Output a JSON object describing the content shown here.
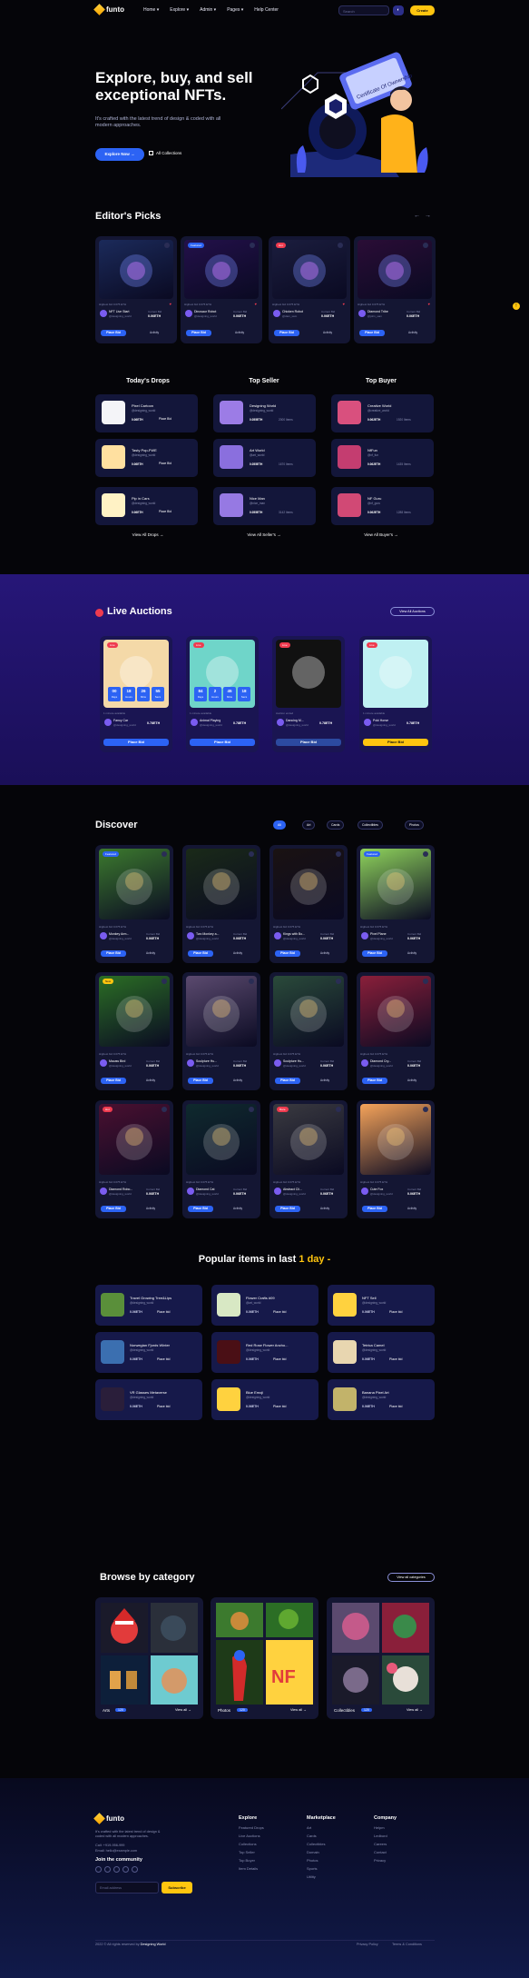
{
  "header": {
    "logo_text": "funto",
    "nav": [
      "Home ▾",
      "Explore ▾",
      "Admin ▾",
      "Pages ▾",
      "Help Center"
    ],
    "search_placeholder": "Search",
    "create_label": "Create"
  },
  "hero": {
    "title": "Explore, buy, and sell exceptional NFTs.",
    "subtitle": "It's crafted with the latest trend of design & coded with all modern approaches.",
    "explore_label": "Explore Now →",
    "collections_label": "All Collections",
    "certificate_text": "Certificate Of Ownership"
  },
  "editors_picks": {
    "title": "Editor's Picks",
    "cards": [
      {
        "badge": "",
        "meta": "Highest bid 0.075 ETH",
        "name": "NFT Live Start",
        "owner": "@designing_world",
        "price_label": "Current Bid",
        "price": "0.06ETH",
        "bid": "Place Bid",
        "activity": "Activity",
        "color": "#1b2a5a"
      },
      {
        "badge": "Featured",
        "meta": "Highest bid 0.075 ETH",
        "name": "Dinosaur Robot",
        "owner": "@designing_world",
        "price_label": "Current Bid",
        "price": "0.06ETH",
        "bid": "Place Bid",
        "activity": "Activity",
        "color": "#23104a"
      },
      {
        "badge": "Hot",
        "meta": "Highest bid 0.075 ETH",
        "name": "Chicken Robot",
        "owner": "@dam_sam",
        "price_label": "Current Bid",
        "price": "0.06ETH",
        "bid": "Place Bid",
        "activity": "Activity",
        "color": "#1b1d3e"
      },
      {
        "badge": "",
        "meta": "Highest bid 0.075 ETH",
        "name": "Diamond Tribe",
        "owner": "@john_sam",
        "price_label": "Current Bid",
        "price": "0.06ETH",
        "bid": "Place Bid",
        "activity": "Activity",
        "color": "#2a0d36"
      }
    ]
  },
  "drops": {
    "title": "Today's Drops",
    "items": [
      {
        "name": "Pixel Cartoon",
        "owner": "@designing_world",
        "price": "0.06ETH",
        "bid": "Place Bid",
        "color": "#f4f4f8"
      },
      {
        "name": "Tasty Pop-FWE",
        "owner": "@designing_world",
        "price": "0.06ETH",
        "bid": "Place Bid",
        "color": "#ffe0a0"
      },
      {
        "name": "Pip in Cars",
        "owner": "@designing_world",
        "price": "0.06ETH",
        "bid": "Place Bid",
        "color": "#fff2c5"
      }
    ],
    "view_all": "View All Drops →"
  },
  "sellers": {
    "title": "Top Seller",
    "items": [
      {
        "name": "Designing World",
        "handle": "@designing_world",
        "amount": "0.055ETH",
        "items": "2000 Items",
        "color": "#9c7ce6"
      },
      {
        "name": "Art World",
        "handle": "@art_world",
        "amount": "0.055ETH",
        "items": "1670 Items",
        "color": "#8a6fde"
      },
      {
        "name": "Nice Man",
        "handle": "@nice_man",
        "amount": "0.055ETH",
        "items": "3142 Items",
        "color": "#9679e3"
      }
    ],
    "view_all": "View All Seller's →"
  },
  "buyers": {
    "title": "Top Buyer",
    "items": [
      {
        "name": "Creative World",
        "handle": "@creative_world",
        "amount": "0.062ETH",
        "items": "1920 Items",
        "color": "#d9507e"
      },
      {
        "name": "NfFun",
        "handle": "@nf_fun",
        "amount": "0.062ETH",
        "items": "1435 Items",
        "color": "#c43d70"
      },
      {
        "name": "NF Guru",
        "handle": "@nf_guru",
        "amount": "0.062ETH",
        "items": "1288 Items",
        "color": "#d14975"
      }
    ],
    "view_all": "View All Buyer's →"
  },
  "auctions": {
    "title": "Live Auctions",
    "view_all": "View All Auctions",
    "cards": [
      {
        "name": "Fancy Car",
        "owner": "@designing_world",
        "price": "0.78ETH",
        "countdown": [
          "00",
          "18",
          "26",
          "55"
        ],
        "units": [
          "Days",
          "Hours",
          "Mins",
          "Secs"
        ],
        "bid": "Place Bid",
        "meta": "1 minute available",
        "color": "#f4d9a8"
      },
      {
        "name": "Animal Playing",
        "owner": "@designing_world",
        "price": "0.78ETH",
        "countdown": [
          "84",
          "2",
          "45",
          "18"
        ],
        "units": [
          "Days",
          "Hours",
          "Mins",
          "Secs"
        ],
        "bid": "Place Bid",
        "meta": "1 minute available",
        "color": "#6fd5c9"
      },
      {
        "name": "Dancing M...",
        "owner": "@designing_world",
        "price": "0.78ETH",
        "countdown": [],
        "units": [],
        "bid": "Place Bid",
        "meta": "Auction ended",
        "color": "#111111"
      },
      {
        "name": "Poki Horse",
        "owner": "@designing_world",
        "price": "0.78ETH",
        "countdown": [],
        "units": [],
        "bid": "Place Bid",
        "meta": "1 minute available",
        "color": "#bff0f2"
      }
    ]
  },
  "discover": {
    "title": "Discover",
    "filters": [
      "All",
      "Art",
      "Cards",
      "Collectibles",
      "Photos"
    ],
    "cards": [
      {
        "name": "Monkey Arm...",
        "price": "0.06ETH",
        "badge": "Featured",
        "color": "#3c7a2e"
      },
      {
        "name": "Two Monkey a...",
        "price": "0.06ETH",
        "badge": "",
        "color": "#1a2a18"
      },
      {
        "name": "Kings with Bo...",
        "price": "0.06ETH",
        "badge": "",
        "color": "#1a1212"
      },
      {
        "name": "Pixel Plane",
        "price": "0.06ETH",
        "badge": "Featured",
        "color": "#8fd35c"
      },
      {
        "name": "Macaw Bird",
        "price": "0.06ETH",
        "badge": "New",
        "color": "#2b6e25"
      },
      {
        "name": "Sculpture Hu...",
        "price": "0.06ETH",
        "badge": "",
        "color": "#5b4a6f"
      },
      {
        "name": "Sculpture Hu...",
        "price": "0.06ETH",
        "badge": "",
        "color": "#2a4a3a"
      },
      {
        "name": "Diamond Cry...",
        "price": "0.06ETH",
        "badge": "",
        "color": "#8a1f3a"
      },
      {
        "name": "Diamond Robo...",
        "price": "0.06ETH",
        "badge": "Hot",
        "color": "#4a1030"
      },
      {
        "name": "Diamond Cat",
        "price": "0.06ETH",
        "badge": "",
        "color": "#0f2a2e"
      },
      {
        "name": "Abstract Cli...",
        "price": "0.06ETH",
        "badge": "Rare",
        "color": "#3a3a40"
      },
      {
        "name": "Cute Fox",
        "price": "0.06ETH",
        "badge": "",
        "color": "#f5a35a"
      }
    ],
    "bid": "Place Bid",
    "activity": "Activity",
    "owner": "@designing_world",
    "price_label": "Current Bid",
    "meta": "Highest bid 0.075 ETH"
  },
  "popular": {
    "title_prefix": "Popular items in last",
    "title_highlight": "1 day",
    "items": [
      {
        "name": "Travel Growing Tree&Lips",
        "owner": "@designing_world",
        "price": "0.06ETH",
        "color": "#5a8f3a"
      },
      {
        "name": "Flower Crafts #09",
        "owner": "@art_world",
        "price": "0.06ETH",
        "color": "#d8e8c4"
      },
      {
        "name": "NFT Sell",
        "owner": "@designing_world",
        "price": "0.06ETH",
        "color": "#ffd23f"
      },
      {
        "name": "Norwegian Fjords Winter",
        "owner": "@designing_world",
        "price": "0.06ETH",
        "color": "#3b6fb0"
      },
      {
        "name": "Red Rose Flower Ancho...",
        "owner": "@designing_world",
        "price": "0.06ETH",
        "color": "#4a0f15"
      },
      {
        "name": "Tetrica Camel",
        "owner": "@designing_world",
        "price": "0.06ETH",
        "color": "#e8d6b0"
      },
      {
        "name": "VR Glasses Metaverse",
        "owner": "@designing_world",
        "price": "0.06ETH",
        "color": "#2a1e3a"
      },
      {
        "name": "Blue Emoji",
        "owner": "@designing_world",
        "price": "0.06ETH",
        "color": "#ffd23f"
      },
      {
        "name": "Banana Pixel Art",
        "owner": "@designing_world",
        "price": "0.06ETH",
        "color": "#c2b36a"
      }
    ],
    "bid": "Place bid"
  },
  "categories": {
    "title": "Browse by category",
    "view_all": "View all categories",
    "items": [
      {
        "name": "Arts",
        "count": "120",
        "view": "View all →"
      },
      {
        "name": "Photos",
        "count": "120",
        "view": "View all →"
      },
      {
        "name": "Collectibles",
        "count": "120",
        "view": "View all →"
      }
    ]
  },
  "footer": {
    "logo_text": "funto",
    "about": "It's crafted with the latest trend of design & coded with all modern approaches.",
    "call": "Call: +919-956-999",
    "email": "Email: hello@example.com",
    "community_title": "Join the community",
    "email_placeholder": "Email address",
    "subscribe": "Subscribe",
    "explore_title": "Explore",
    "explore_links": [
      "Featured Drops",
      "Live Auctions",
      "Collections",
      "Top Seller",
      "Top Buyer",
      "Item Details"
    ],
    "market_title": "Marketplace",
    "market_links": [
      "Art",
      "Cards",
      "Collectibles",
      "Domain",
      "Photos",
      "Sports",
      "Utility"
    ],
    "company_title": "Company",
    "company_links": [
      "Helpm",
      "Ledbord",
      "Careers",
      "Contact",
      "Privacy"
    ],
    "copyright_prefix": "2022 © All rights reserved by",
    "copyright_brand": "Designing World",
    "privacy": "Privacy Policy",
    "terms": "Terms & Conditions"
  }
}
